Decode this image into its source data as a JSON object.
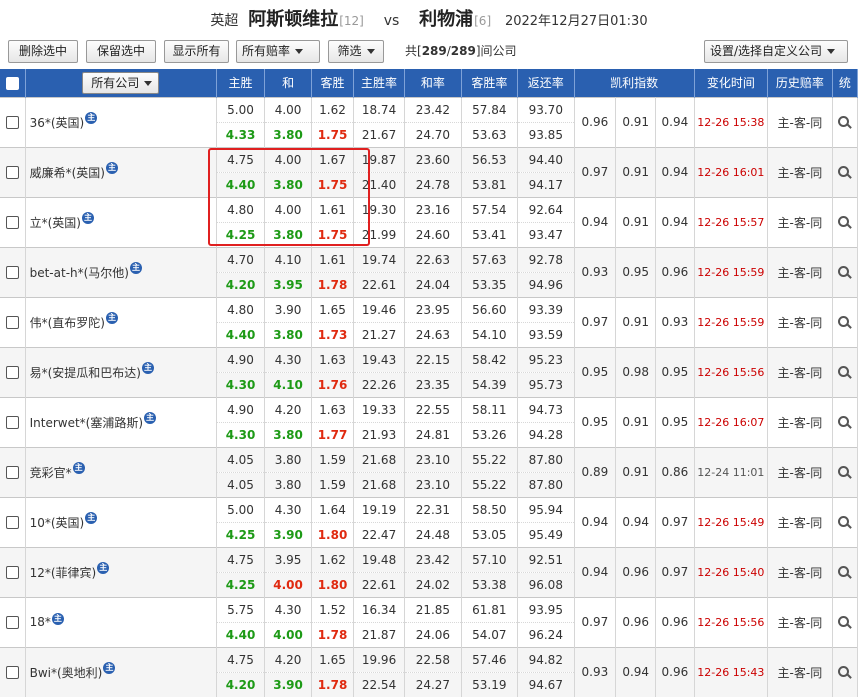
{
  "header": {
    "league": "英超",
    "home_team": "阿斯顿维拉",
    "home_rank": "[12]",
    "vs": "vs",
    "away_team": "利物浦",
    "away_rank": "[6]",
    "datetime": "2022年12月27日01:30"
  },
  "toolbar": {
    "delete_selected": "删除选中",
    "keep_selected": "保留选中",
    "show_all": "显示所有",
    "odds_filter": "所有赔率",
    "filter": "筛选",
    "count_prefix": "共[",
    "count_shown": "289",
    "count_sep": "/",
    "count_total": "289",
    "count_suffix": "]间公司",
    "custom_company": "设置/选择自定义公司"
  },
  "table_header": {
    "all_companies": "所有公司",
    "home_win": "主胜",
    "draw": "和",
    "away_win": "客胜",
    "home_rate": "主胜率",
    "draw_rate": "和率",
    "away_rate": "客胜率",
    "return_rate": "返还率",
    "kelly": "凯利指数",
    "change_time": "变化时间",
    "history_odds": "历史赔率",
    "stats": "统"
  },
  "icons": {
    "info": "info-icon",
    "search": "search-icon",
    "checkbox": "checkbox"
  },
  "colors": {
    "header_bg": "#2a60b0",
    "green": "#1d9a16",
    "red": "#e02a10",
    "time_red": "#cc0000",
    "highlight": "#e02020"
  },
  "rows": [
    {
      "company": "36*(英国)",
      "o1": [
        "5.00",
        "4.00",
        "1.62"
      ],
      "o2": [
        "4.33",
        "3.80",
        "1.75"
      ],
      "c2": [
        "green",
        "green",
        "red"
      ],
      "r1": [
        "18.74",
        "23.42",
        "57.84",
        "93.70"
      ],
      "r2": [
        "21.67",
        "24.70",
        "53.63",
        "93.85"
      ],
      "kelly": [
        "0.96",
        "0.91",
        "0.94"
      ],
      "time": "12-26 15:38",
      "time_red": true,
      "hist": "主-客-同"
    },
    {
      "company": "威廉希*(英国)",
      "o1": [
        "4.75",
        "4.00",
        "1.67"
      ],
      "o2": [
        "4.40",
        "3.80",
        "1.75"
      ],
      "c2": [
        "green",
        "green",
        "red"
      ],
      "r1": [
        "19.87",
        "23.60",
        "56.53",
        "94.40"
      ],
      "r2": [
        "21.40",
        "24.78",
        "53.81",
        "94.17"
      ],
      "kelly": [
        "0.97",
        "0.91",
        "0.94"
      ],
      "time": "12-26 16:01",
      "time_red": true,
      "hist": "主-客-同"
    },
    {
      "company": "立*(英国)",
      "o1": [
        "4.80",
        "4.00",
        "1.61"
      ],
      "o2": [
        "4.25",
        "3.80",
        "1.75"
      ],
      "c2": [
        "green",
        "green",
        "red"
      ],
      "r1": [
        "19.30",
        "23.16",
        "57.54",
        "92.64"
      ],
      "r2": [
        "21.99",
        "24.60",
        "53.41",
        "93.47"
      ],
      "kelly": [
        "0.94",
        "0.91",
        "0.94"
      ],
      "time": "12-26 15:57",
      "time_red": true,
      "hist": "主-客-同"
    },
    {
      "company": "bet-at-h*(马尔他)",
      "o1": [
        "4.70",
        "4.10",
        "1.61"
      ],
      "o2": [
        "4.20",
        "3.95",
        "1.78"
      ],
      "c2": [
        "green",
        "green",
        "red"
      ],
      "r1": [
        "19.74",
        "22.63",
        "57.63",
        "92.78"
      ],
      "r2": [
        "22.61",
        "24.04",
        "53.35",
        "94.96"
      ],
      "kelly": [
        "0.93",
        "0.95",
        "0.96"
      ],
      "time": "12-26 15:59",
      "time_red": true,
      "hist": "主-客-同"
    },
    {
      "company": "伟*(直布罗陀)",
      "o1": [
        "4.80",
        "3.90",
        "1.65"
      ],
      "o2": [
        "4.40",
        "3.80",
        "1.73"
      ],
      "c2": [
        "green",
        "green",
        "red"
      ],
      "r1": [
        "19.46",
        "23.95",
        "56.60",
        "93.39"
      ],
      "r2": [
        "21.27",
        "24.63",
        "54.10",
        "93.59"
      ],
      "kelly": [
        "0.97",
        "0.91",
        "0.93"
      ],
      "time": "12-26 15:59",
      "time_red": true,
      "hist": "主-客-同"
    },
    {
      "company": "易*(安提瓜和巴布达)",
      "o1": [
        "4.90",
        "4.30",
        "1.63"
      ],
      "o2": [
        "4.30",
        "4.10",
        "1.76"
      ],
      "c2": [
        "green",
        "green",
        "red"
      ],
      "r1": [
        "19.43",
        "22.15",
        "58.42",
        "95.23"
      ],
      "r2": [
        "22.26",
        "23.35",
        "54.39",
        "95.73"
      ],
      "kelly": [
        "0.95",
        "0.98",
        "0.95"
      ],
      "time": "12-26 15:56",
      "time_red": true,
      "hist": "主-客-同"
    },
    {
      "company": "Interwet*(塞浦路斯)",
      "o1": [
        "4.90",
        "4.20",
        "1.63"
      ],
      "o2": [
        "4.30",
        "3.80",
        "1.77"
      ],
      "c2": [
        "green",
        "green",
        "red"
      ],
      "r1": [
        "19.33",
        "22.55",
        "58.11",
        "94.73"
      ],
      "r2": [
        "21.93",
        "24.81",
        "53.26",
        "94.28"
      ],
      "kelly": [
        "0.95",
        "0.91",
        "0.95"
      ],
      "time": "12-26 16:07",
      "time_red": true,
      "hist": "主-客-同"
    },
    {
      "company": "竞彩官*",
      "o1": [
        "4.05",
        "3.80",
        "1.59"
      ],
      "o2": [
        "4.05",
        "3.80",
        "1.59"
      ],
      "c2": [
        "",
        "",
        ""
      ],
      "r1": [
        "21.68",
        "23.10",
        "55.22",
        "87.80"
      ],
      "r2": [
        "21.68",
        "23.10",
        "55.22",
        "87.80"
      ],
      "kelly": [
        "0.89",
        "0.91",
        "0.86"
      ],
      "time": "12-24 11:01",
      "time_red": false,
      "hist": "主-客-同"
    },
    {
      "company": "10*(英国)",
      "o1": [
        "5.00",
        "4.30",
        "1.64"
      ],
      "o2": [
        "4.25",
        "3.90",
        "1.80"
      ],
      "c2": [
        "green",
        "green",
        "red"
      ],
      "r1": [
        "19.19",
        "22.31",
        "58.50",
        "95.94"
      ],
      "r2": [
        "22.47",
        "24.48",
        "53.05",
        "95.49"
      ],
      "kelly": [
        "0.94",
        "0.94",
        "0.97"
      ],
      "time": "12-26 15:49",
      "time_red": true,
      "hist": "主-客-同"
    },
    {
      "company": "12*(菲律宾)",
      "o1": [
        "4.75",
        "3.95",
        "1.62"
      ],
      "o2": [
        "4.25",
        "4.00",
        "1.80"
      ],
      "c2": [
        "green",
        "red",
        "red"
      ],
      "r1": [
        "19.48",
        "23.42",
        "57.10",
        "92.51"
      ],
      "r2": [
        "22.61",
        "24.02",
        "53.38",
        "96.08"
      ],
      "kelly": [
        "0.94",
        "0.96",
        "0.97"
      ],
      "time": "12-26 15:40",
      "time_red": true,
      "hist": "主-客-同"
    },
    {
      "company": "18*",
      "o1": [
        "5.75",
        "4.30",
        "1.52"
      ],
      "o2": [
        "4.40",
        "4.00",
        "1.78"
      ],
      "c2": [
        "green",
        "green",
        "red"
      ],
      "r1": [
        "16.34",
        "21.85",
        "61.81",
        "93.95"
      ],
      "r2": [
        "21.87",
        "24.06",
        "54.07",
        "96.24"
      ],
      "kelly": [
        "0.97",
        "0.96",
        "0.96"
      ],
      "time": "12-26 15:56",
      "time_red": true,
      "hist": "主-客-同"
    },
    {
      "company": "Bwi*(奥地利)",
      "o1": [
        "4.75",
        "4.20",
        "1.65"
      ],
      "o2": [
        "4.20",
        "3.90",
        "1.78"
      ],
      "c2": [
        "green",
        "green",
        "red"
      ],
      "r1": [
        "19.96",
        "22.58",
        "57.46",
        "94.82"
      ],
      "r2": [
        "22.54",
        "24.27",
        "53.19",
        "94.67"
      ],
      "kelly": [
        "0.93",
        "0.94",
        "0.96"
      ],
      "time": "12-26 15:43",
      "time_red": true,
      "hist": "主-客-同"
    }
  ]
}
